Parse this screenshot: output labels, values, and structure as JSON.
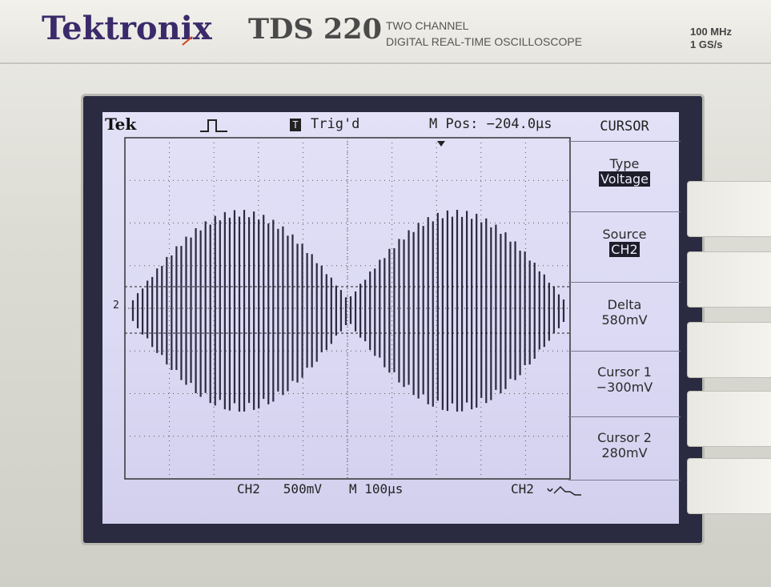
{
  "header": {
    "brand": "Tektronix",
    "model": "TDS 220",
    "subtitle_line1": "TWO CHANNEL",
    "subtitle_line2": "DIGITAL REAL-TIME OSCILLOSCOPE",
    "spec_bandwidth": "100 MHz",
    "spec_samplerate": "1 GS/s"
  },
  "status_bar": {
    "logo": "Tek",
    "trig_icon": "T",
    "trig_status": "Trig'd",
    "mpos": "M Pos: −204.0µs",
    "acquire_icon": "square-pulse-icon"
  },
  "menu": {
    "title": "CURSOR",
    "items": [
      {
        "label": "Type",
        "value": "Voltage",
        "inverted": true
      },
      {
        "label": "Source",
        "value": "CH2",
        "inverted": true
      },
      {
        "label": "Delta",
        "value": "580mV",
        "inverted": false
      },
      {
        "label": "Cursor 1",
        "value": "−300mV",
        "inverted": false
      },
      {
        "label": "Cursor 2",
        "value": "280mV",
        "inverted": false
      }
    ]
  },
  "footer": {
    "channel_scale": "CH2   500mV",
    "timebase": "M 100µs",
    "trigger_source": "CH2"
  },
  "ch_marker": "2",
  "colors": {
    "trace": "#2c2a40",
    "screen_bg": "#dcdaf4",
    "brand": "#3b2a6a"
  }
}
